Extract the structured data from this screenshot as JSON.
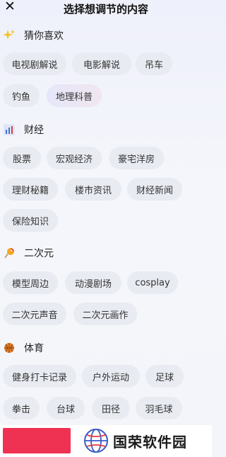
{
  "header": {
    "title": "选择想调节的内容",
    "close_icon": "close-icon"
  },
  "sections": [
    {
      "label": "猜你喜欢",
      "icon": "sparkles-icon",
      "chips": [
        "电视剧解说",
        "电影解说",
        "吊车",
        "钓鱼",
        "地理科普"
      ],
      "selected": "地理科普"
    },
    {
      "label": "财经",
      "icon": "bar-chart-icon",
      "chips": [
        "股票",
        "宏观经济",
        "豪宅洋房",
        "理财秘籍",
        "楼市资讯",
        "财经新闻",
        "保险知识"
      ]
    },
    {
      "label": "二次元",
      "icon": "lollipop-icon",
      "chips": [
        "模型周边",
        "动漫剧场",
        "cosplay",
        "二次元声音",
        "二次元画作"
      ]
    },
    {
      "label": "体育",
      "icon": "basketball-icon",
      "chips": [
        "健身打卡记录",
        "户外运动",
        "足球",
        "拳击",
        "台球",
        "田径",
        "羽毛球"
      ]
    }
  ],
  "watermark": {
    "text": "国荣软件园"
  },
  "colors": {
    "accent_red": "#f03252",
    "chip_bg": "#e9ebf2"
  }
}
